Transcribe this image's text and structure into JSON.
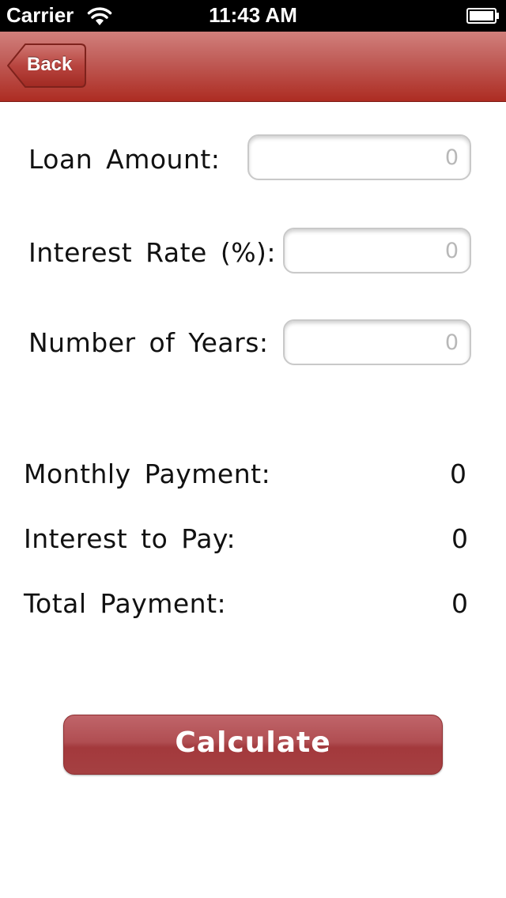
{
  "status_bar": {
    "carrier": "Carrier",
    "time": "11:43 AM",
    "wifi_icon": "wifi-icon",
    "battery_icon": "battery-icon"
  },
  "nav": {
    "back_label": "Back"
  },
  "form": {
    "loan_amount_label": "Loan Amount:",
    "loan_amount_placeholder": "0",
    "interest_rate_label": "Interest Rate (%):",
    "interest_rate_placeholder": "0",
    "years_label": "Number of Years:",
    "years_placeholder": "0"
  },
  "results": {
    "monthly_payment_label": "Monthly Payment:",
    "monthly_payment_value": "0",
    "interest_to_pay_label": "Interest to Pay:",
    "interest_to_pay_value": "0",
    "total_payment_label": "Total Payment:",
    "total_payment_value": "0"
  },
  "actions": {
    "calculate_label": "Calculate"
  },
  "colors": {
    "nav_bar": "#bf5a55",
    "button": "#a54042",
    "text": "#111111"
  }
}
